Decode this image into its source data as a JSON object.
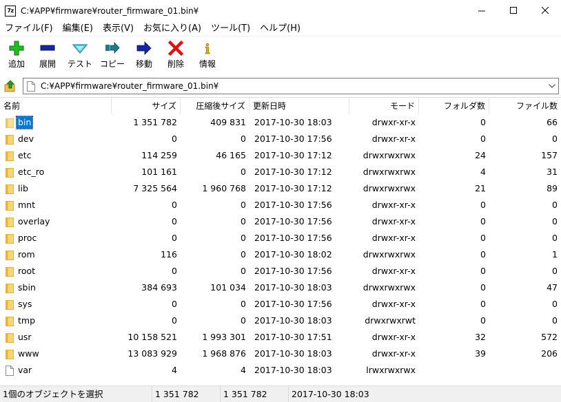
{
  "window": {
    "title": "C:¥APP¥firmware¥router_firmware_01.bin¥",
    "app_icon_label": "7z"
  },
  "menu": [
    "ファイル(F)",
    "編集(E)",
    "表示(V)",
    "お気に入り(A)",
    "ツール(T)",
    "ヘルプ(H)"
  ],
  "toolbar": [
    {
      "label": "追加",
      "icon": "plus-icon",
      "color": "#1fbf1f"
    },
    {
      "label": "展開",
      "icon": "minus-icon",
      "color": "#1428a0"
    },
    {
      "label": "テスト",
      "icon": "check-icon",
      "color": "#2aa5c6"
    },
    {
      "label": "コピー",
      "icon": "copy-arrow-icon",
      "color": "#1e7a8c"
    },
    {
      "label": "移動",
      "icon": "move-arrow-icon",
      "color": "#1428a0"
    },
    {
      "label": "削除",
      "icon": "delete-x-icon",
      "color": "#e01010"
    },
    {
      "label": "情報",
      "icon": "info-icon",
      "color": "#d4a800"
    }
  ],
  "address": {
    "path": "C:¥APP¥firmware¥router_firmware_01.bin¥"
  },
  "columns": {
    "name": "名前",
    "size": "サイズ",
    "compressed": "圧縮後サイズ",
    "modified": "更新日時",
    "mode": "モード",
    "folders": "フォルダ数",
    "files": "ファイル数"
  },
  "rows": [
    {
      "name": "bin",
      "size": "1 351 782",
      "compressed": "409 831",
      "modified": "2017-10-30 18:03",
      "mode": "drwxr-xr-x",
      "folders": "0",
      "files": "66",
      "type": "folder",
      "selected": true
    },
    {
      "name": "dev",
      "size": "0",
      "compressed": "0",
      "modified": "2017-10-30 17:56",
      "mode": "drwxr-xr-x",
      "folders": "0",
      "files": "0",
      "type": "folder"
    },
    {
      "name": "etc",
      "size": "114 259",
      "compressed": "46 165",
      "modified": "2017-10-30 17:12",
      "mode": "drwxrwxrwx",
      "folders": "24",
      "files": "157",
      "type": "folder"
    },
    {
      "name": "etc_ro",
      "size": "101 161",
      "compressed": "0",
      "modified": "2017-10-30 17:12",
      "mode": "drwxrwxrwx",
      "folders": "4",
      "files": "31",
      "type": "folder"
    },
    {
      "name": "lib",
      "size": "7 325 564",
      "compressed": "1 960 768",
      "modified": "2017-10-30 17:12",
      "mode": "drwxrwxrwx",
      "folders": "21",
      "files": "89",
      "type": "folder"
    },
    {
      "name": "mnt",
      "size": "0",
      "compressed": "0",
      "modified": "2017-10-30 17:56",
      "mode": "drwxr-xr-x",
      "folders": "0",
      "files": "0",
      "type": "folder"
    },
    {
      "name": "overlay",
      "size": "0",
      "compressed": "0",
      "modified": "2017-10-30 17:56",
      "mode": "drwxr-xr-x",
      "folders": "0",
      "files": "0",
      "type": "folder"
    },
    {
      "name": "proc",
      "size": "0",
      "compressed": "0",
      "modified": "2017-10-30 17:56",
      "mode": "drwxr-xr-x",
      "folders": "0",
      "files": "0",
      "type": "folder"
    },
    {
      "name": "rom",
      "size": "116",
      "compressed": "0",
      "modified": "2017-10-30 18:02",
      "mode": "drwxrwxrwx",
      "folders": "0",
      "files": "1",
      "type": "folder"
    },
    {
      "name": "root",
      "size": "0",
      "compressed": "0",
      "modified": "2017-10-30 17:56",
      "mode": "drwxr-xr-x",
      "folders": "0",
      "files": "0",
      "type": "folder"
    },
    {
      "name": "sbin",
      "size": "384 693",
      "compressed": "101 034",
      "modified": "2017-10-30 18:03",
      "mode": "drwxrwxrwx",
      "folders": "0",
      "files": "47",
      "type": "folder"
    },
    {
      "name": "sys",
      "size": "0",
      "compressed": "0",
      "modified": "2017-10-30 17:56",
      "mode": "drwxr-xr-x",
      "folders": "0",
      "files": "0",
      "type": "folder"
    },
    {
      "name": "tmp",
      "size": "0",
      "compressed": "0",
      "modified": "2017-10-30 18:03",
      "mode": "drwxrwxrwt",
      "folders": "0",
      "files": "0",
      "type": "folder"
    },
    {
      "name": "usr",
      "size": "10 158 521",
      "compressed": "1 993 301",
      "modified": "2017-10-30 17:51",
      "mode": "drwxr-xr-x",
      "folders": "32",
      "files": "572",
      "type": "folder"
    },
    {
      "name": "www",
      "size": "13 083 929",
      "compressed": "1 968 876",
      "modified": "2017-10-30 18:03",
      "mode": "drwxr-xr-x",
      "folders": "39",
      "files": "206",
      "type": "folder"
    },
    {
      "name": "var",
      "size": "4",
      "compressed": "4",
      "modified": "2017-10-30 18:03",
      "mode": "lrwxrwxrwx",
      "folders": "",
      "files": "",
      "type": "file"
    }
  ],
  "status": {
    "selection": "1個のオブジェクトを選択",
    "size": "1 351 782",
    "compressed": "1 351 782",
    "modified": "2017-10-30 18:03"
  },
  "colors": {
    "folder": "#f8d675",
    "folder_dark": "#e6b43c",
    "selection": "#0078d7"
  }
}
